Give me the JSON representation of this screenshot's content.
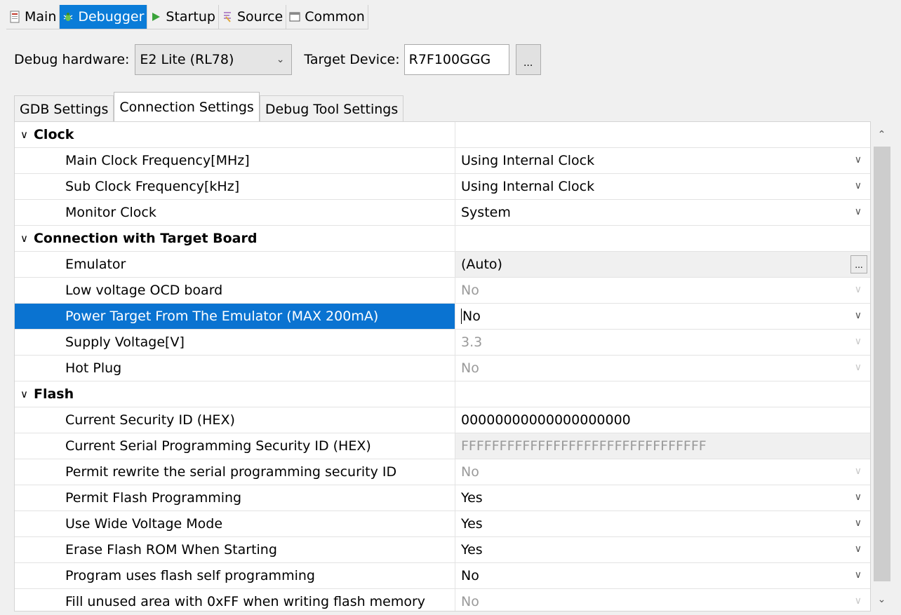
{
  "top_tabs": [
    {
      "label": "Main",
      "icon": "main-tab-icon"
    },
    {
      "label": "Debugger",
      "icon": "debugger-bug-icon"
    },
    {
      "label": "Startup",
      "icon": "startup-play-icon"
    },
    {
      "label": "Source",
      "icon": "source-icon"
    },
    {
      "label": "Common",
      "icon": "common-icon"
    }
  ],
  "active_top_tab": "Debugger",
  "hardware": {
    "label": "Debug hardware:",
    "value": "E2 Lite (RL78)",
    "target_label": "Target Device:",
    "target_value": "R7F100GGG",
    "browse_label": "..."
  },
  "sub_tabs": [
    "GDB Settings",
    "Connection Settings",
    "Debug Tool Settings"
  ],
  "active_sub_tab": "Connection Settings",
  "table": {
    "rows": [
      {
        "type": "cat",
        "name": "Clock"
      },
      {
        "type": "prop",
        "name": "Main Clock Frequency[MHz]",
        "value": "Using Internal Clock",
        "control": "dropdown"
      },
      {
        "type": "prop",
        "name": "Sub Clock Frequency[kHz]",
        "value": "Using Internal Clock",
        "control": "dropdown"
      },
      {
        "type": "prop",
        "name": "Monitor Clock",
        "value": "System",
        "control": "dropdown"
      },
      {
        "type": "cat",
        "name": "Connection with Target Board"
      },
      {
        "type": "prop",
        "name": "Emulator",
        "value": "(Auto)",
        "control": "button",
        "button_label": "...",
        "grey": true
      },
      {
        "type": "prop",
        "name": "Low voltage OCD board",
        "value": "No",
        "control": "dropdown",
        "disabled": true
      },
      {
        "type": "prop",
        "name": "Power Target From The Emulator (MAX 200mA)",
        "value": "No",
        "control": "dropdown",
        "selected": true
      },
      {
        "type": "prop",
        "name": "Supply Voltage[V]",
        "value": "3.3",
        "control": "dropdown",
        "disabled": true
      },
      {
        "type": "prop",
        "name": "Hot Plug",
        "value": "No",
        "control": "dropdown",
        "disabled": true
      },
      {
        "type": "cat",
        "name": "Flash"
      },
      {
        "type": "prop",
        "name": "Current Security ID (HEX)",
        "value": "00000000000000000000",
        "control": "text"
      },
      {
        "type": "prop",
        "name": "Current Serial Programming Security ID (HEX)",
        "value": "FFFFFFFFFFFFFFFFFFFFFFFFFFFFFFFF",
        "control": "text",
        "disabled": true,
        "grey": true
      },
      {
        "type": "prop",
        "name": "Permit rewrite the serial programming security ID",
        "value": "No",
        "control": "dropdown",
        "disabled": true
      },
      {
        "type": "prop",
        "name": "Permit Flash Programming",
        "value": "Yes",
        "control": "dropdown"
      },
      {
        "type": "prop",
        "name": "Use Wide Voltage Mode",
        "value": "Yes",
        "control": "dropdown"
      },
      {
        "type": "prop",
        "name": "Erase Flash ROM When Starting",
        "value": "Yes",
        "control": "dropdown"
      },
      {
        "type": "prop",
        "name": "Program uses flash self programming",
        "value": "No",
        "control": "dropdown"
      },
      {
        "type": "prop",
        "name": "Fill unused area with 0xFF when writing flash memory",
        "value": "No",
        "control": "dropdown",
        "disabled": true
      }
    ]
  },
  "scrollbar": {
    "up_icon": "scroll-up-arrow-icon",
    "down_icon": "scroll-down-arrow-icon"
  }
}
